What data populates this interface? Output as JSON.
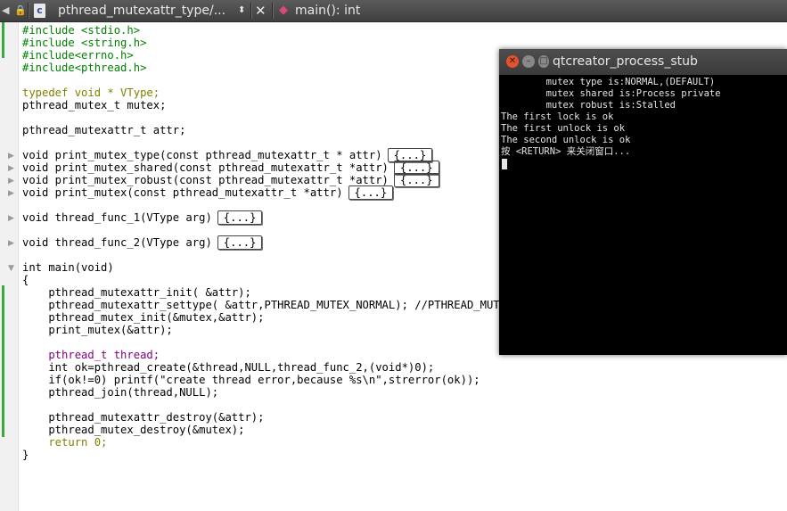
{
  "topbar": {
    "filename": "pthread_mutexattr_type/...",
    "function": "main(): int",
    "file_type_icon_text": "c"
  },
  "code": [
    "#include <stdio.h>",
    "#include <string.h>",
    "#include<errno.h>",
    "#include<pthread.h>",
    "",
    "typedef void * VType;",
    "pthread_mutex_t mutex;",
    "",
    "pthread_mutexattr_t attr;",
    "",
    "void print_mutex_type(const pthread_mutexattr_t * attr)",
    "void print_mutex_shared(const pthread_mutexattr_t *attr)",
    "void print_mutex_robust(const pthread_mutexattr_t *attr)",
    "void print_mutex(const pthread_mutexattr_t *attr)",
    "",
    "void thread_func_1(VType arg)",
    "",
    "void thread_func_2(VType arg)",
    "",
    "int main(void)",
    "{",
    "    pthread_mutexattr_init( &attr);",
    "    pthread_mutexattr_settype( &attr,PTHREAD_MUTEX_NORMAL); //PTHREAD_MUTE",
    "    pthread_mutex_init(&mutex,&attr);",
    "    print_mutex(&attr);",
    "",
    "    pthread_t thread;",
    "    int ok=pthread_create(&thread,NULL,thread_func_2,(void*)0);",
    "    if(ok!=0) printf(\"create thread error,because %s\\n\",strerror(ok));",
    "    pthread_join(thread,NULL);",
    "",
    "    pthread_mutexattr_destroy(&attr);",
    "    pthread_mutex_destroy(&mutex);",
    "    return 0;",
    "}"
  ],
  "collapsed_label": "{...}",
  "terminal": {
    "title": "qtcreator_process_stub",
    "lines": [
      "        mutex type is:NORMAL,(DEFAULT)",
      "        mutex shared is:Process private",
      "        mutex robust is:Stalled",
      "The first lock is ok",
      "The first unlock is ok",
      "The second unlock is ok",
      "按 <RETURN> 来关闭窗口..."
    ]
  }
}
